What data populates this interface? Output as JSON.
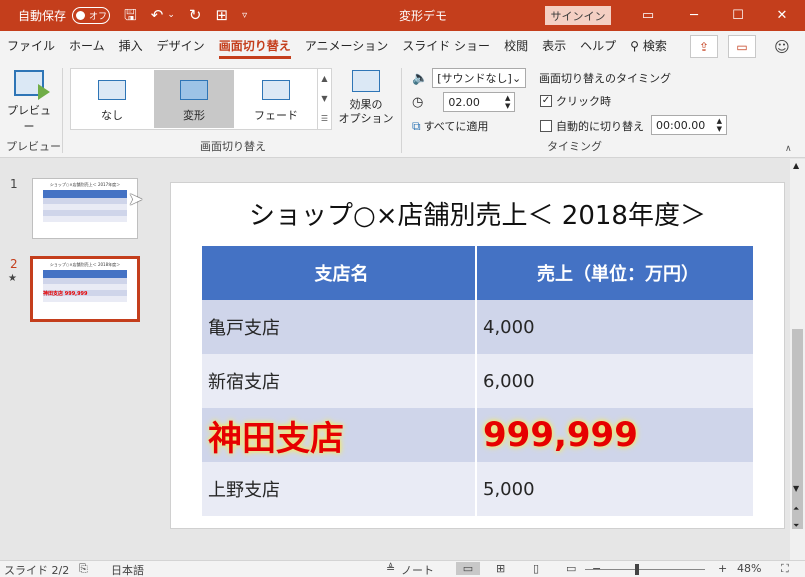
{
  "titlebar": {
    "autosave_label": "自動保存",
    "autosave_state": "オフ",
    "doc_title": "変形デモ",
    "signin_label": "サインイン",
    "accent_color": "#c43e1c"
  },
  "tabs": [
    {
      "label": "ファイル"
    },
    {
      "label": "ホーム"
    },
    {
      "label": "挿入"
    },
    {
      "label": "デザイン"
    },
    {
      "label": "画面切り替え"
    },
    {
      "label": "アニメーション"
    },
    {
      "label": "スライド ショー"
    },
    {
      "label": "校閲"
    },
    {
      "label": "表示"
    },
    {
      "label": "ヘルプ"
    },
    {
      "label": "検索"
    }
  ],
  "ribbon": {
    "preview_label": "プレビュー",
    "preview_group": "プレビュー",
    "transitions_group": "画面切り替え",
    "gallery": [
      {
        "label": "なし"
      },
      {
        "label": "変形"
      },
      {
        "label": "フェード"
      }
    ],
    "effect_options_label": "効果の\nオプション",
    "sound_value": "[サウンドなし]",
    "duration_value": "02.00",
    "apply_all_label": "すべてに適用",
    "timing_header": "画面切り替えのタイミング",
    "on_click_label": "クリック時",
    "auto_label": "自動的に切り替え",
    "auto_time": "00:00.00",
    "timing_group": "タイミング"
  },
  "slides_pane": {
    "slide1_num": "1",
    "slide2_num": "2",
    "star": "★"
  },
  "slide": {
    "title": "ショップ○×店舗別売上＜ 2018年度＞",
    "header": [
      "支店名",
      "売上（単位：万円）"
    ],
    "rows": [
      {
        "name": "亀戸支店",
        "value": "4,000"
      },
      {
        "name": "新宿支店",
        "value": "6,000"
      },
      {
        "name": "神田支店",
        "value": "999,999"
      },
      {
        "name": "上野支店",
        "value": "5,000"
      }
    ],
    "header_color": "#4472c4",
    "highlight_color": "#e60000"
  },
  "statusbar": {
    "slide_info": "スライド 2/2",
    "language": "日本語",
    "notes_label": "ノート",
    "zoom": "48%"
  }
}
